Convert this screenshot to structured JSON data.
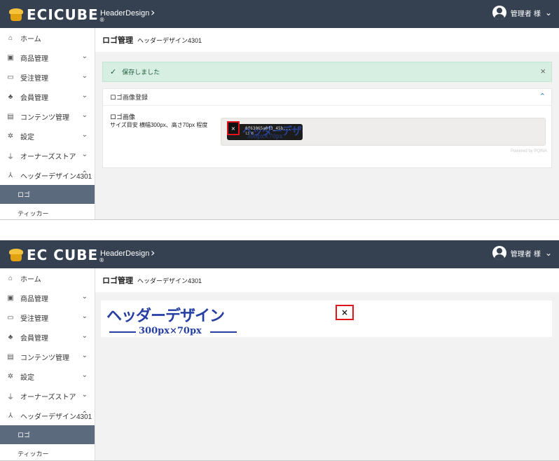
{
  "panel1": {
    "header": {
      "brand": "ECICUBE",
      "reg": "®",
      "link": "HeaderDesign",
      "link_chevron": "›",
      "user": "管理者 様",
      "user_chevron": "⌄"
    },
    "sidebar": {
      "items": [
        {
          "icon": "⌂",
          "label": "ホーム"
        },
        {
          "icon": "▣",
          "label": "商品管理",
          "chevron": "⌄"
        },
        {
          "icon": "▭",
          "label": "受注管理",
          "chevron": "⌄"
        },
        {
          "icon": "♣",
          "label": "会員管理",
          "chevron": "⌄"
        },
        {
          "icon": "▤",
          "label": "コンテンツ管理",
          "chevron": "⌄"
        },
        {
          "icon": "✲",
          "label": "設定",
          "chevron": "⌄"
        },
        {
          "icon": "⏚",
          "label": "オーナーズストア",
          "chevron": "⌄"
        },
        {
          "icon": "⅄",
          "label": "ヘッダーデザイン4301",
          "chevron": "⌃"
        }
      ],
      "sub_items": [
        {
          "label": "ロゴ"
        },
        {
          "label": "ティッカー"
        }
      ]
    },
    "page_title": "ロゴ管理",
    "page_subtitle": "ヘッダーデザイン4301",
    "alert": {
      "icon": "✓",
      "text": "保存しました",
      "close": "×"
    },
    "card": {
      "header": "ロゴ画像登録",
      "collapse_icon": "⌃",
      "label1": "ロゴ画像",
      "label2": "サイズ目安 横幅300px、高さ70px 程度",
      "thumb": {
        "file_name": "0f63065a0f3_45b...",
        "file_size": "13 B",
        "remove": "×",
        "ghost_text": "ヘッダーデザイン",
        "ghost_size": "300px×70px"
      },
      "powered": "Powered by PQINA"
    }
  },
  "panel2": {
    "header": {
      "brand": "EC CUBE",
      "reg": "®",
      "link": "HeaderDesign",
      "link_chevron": "›",
      "user": "管理者 様",
      "user_chevron": "⌄"
    },
    "sidebar": {
      "items": [
        {
          "icon": "⌂",
          "label": "ホーム"
        },
        {
          "icon": "▣",
          "label": "商品管理",
          "chevron": "⌄"
        },
        {
          "icon": "▭",
          "label": "受注管理",
          "chevron": "⌄"
        },
        {
          "icon": "♣",
          "label": "会員管理",
          "chevron": "⌄"
        },
        {
          "icon": "▤",
          "label": "コンテンツ管理",
          "chevron": "⌄"
        },
        {
          "icon": "✲",
          "label": "設定",
          "chevron": "⌄"
        },
        {
          "icon": "⏚",
          "label": "オーナーズストア",
          "chevron": "⌄"
        },
        {
          "icon": "⅄",
          "label": "ヘッダーデザイン4301",
          "chevron": "⌃"
        }
      ],
      "sub_items": [
        {
          "label": "ロゴ"
        },
        {
          "label": "ティッカー"
        }
      ]
    },
    "page_title": "ロゴ管理",
    "page_subtitle": "ヘッダーデザイン4301",
    "logo_preview": {
      "title": "ヘッダーデザイン",
      "size": "300px×70px",
      "remove": "×"
    }
  },
  "colors": {
    "header_bg": "#354050",
    "active_sub_bg": "#5b6a7d",
    "alert_bg": "#d6efe2",
    "logo_blue": "#263fa2",
    "highlight_red": "#e0141b"
  }
}
